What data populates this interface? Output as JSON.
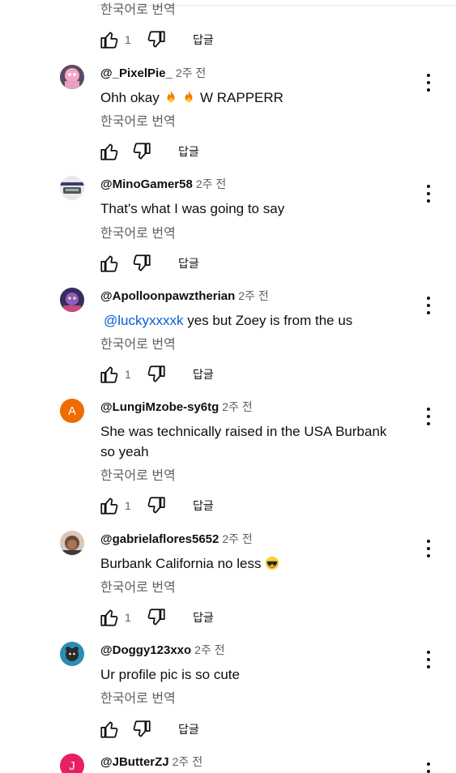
{
  "translate_label": "한국어로 번역",
  "reply_label": "답글",
  "top": {
    "like_count": "1"
  },
  "comments": [
    {
      "handle": "@_PixelPie_",
      "time": "2주 전",
      "text_before": "Ohh okay",
      "text_after": "W RAPPERR",
      "emojis": [
        "fire",
        "fire"
      ],
      "like_count": ""
    },
    {
      "handle": "@MinoGamer58",
      "time": "2주 전",
      "text": "That's what I was going to say",
      "like_count": ""
    },
    {
      "handle": "@Apolloonpawztherian",
      "time": "2주 전",
      "mention": "@luckyxxxxk",
      "text": " yes but Zoey is from the us",
      "like_count": "1"
    },
    {
      "handle": "@LungiMzobe-sy6tg",
      "time": "2주 전",
      "avatar_letter": "A",
      "avatar_color": "#ef6c00",
      "text": "She was technically raised in the USA Burbank so yeah",
      "like_count": "1"
    },
    {
      "handle": "@gabrielaflores5652",
      "time": "2주 전",
      "text": "Burbank California no less",
      "emojis": [
        "sunglasses-face"
      ],
      "like_count": "1"
    },
    {
      "handle": "@Doggy123xxo",
      "time": "2주 전",
      "text": "Ur profile pic is so cute",
      "like_count": ""
    },
    {
      "handle": "@JButterZJ",
      "time": "2주 전",
      "avatar_letter": "J",
      "avatar_color": "#e91e63"
    }
  ]
}
